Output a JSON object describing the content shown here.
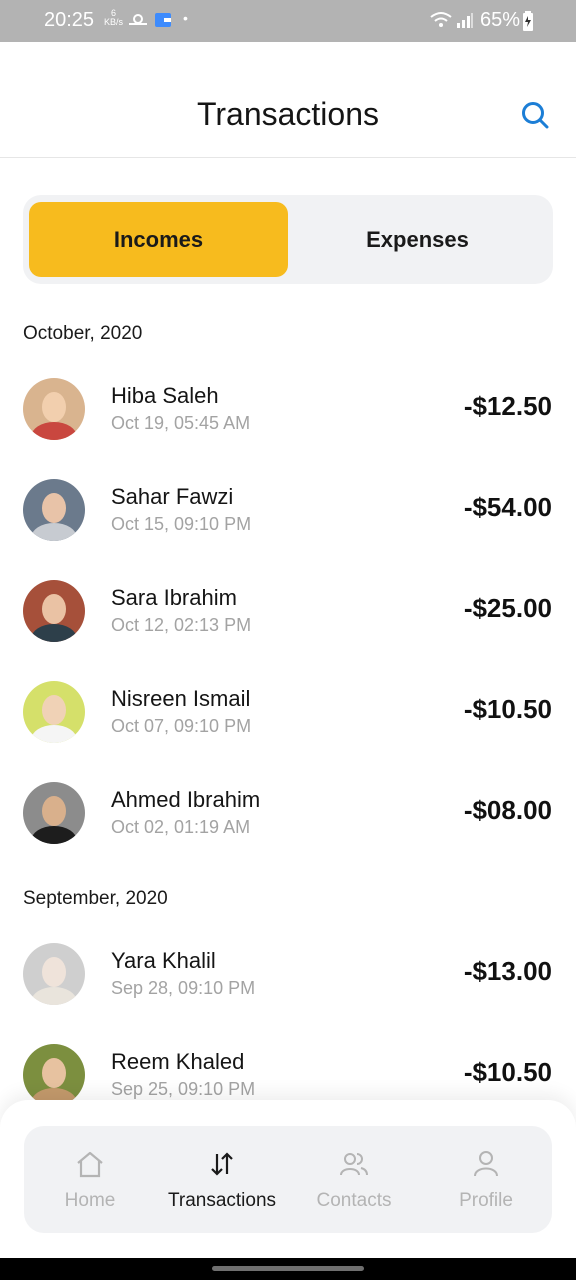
{
  "status_bar": {
    "time": "20:25",
    "kbs_value": "6",
    "kbs_unit": "KB/s",
    "battery": "65%"
  },
  "header": {
    "title": "Transactions"
  },
  "tabs": [
    {
      "label": "Incomes",
      "active": true
    },
    {
      "label": "Expenses",
      "active": false
    }
  ],
  "sections": [
    {
      "title": "October, 2020",
      "items": [
        {
          "name": "Hiba Saleh",
          "date": "Oct 19, 05:45 AM",
          "amount": "-$12.50"
        },
        {
          "name": "Sahar Fawzi",
          "date": "Oct 15, 09:10 PM",
          "amount": "-$54.00"
        },
        {
          "name": "Sara Ibrahim",
          "date": "Oct 12, 02:13 PM",
          "amount": "-$25.00"
        },
        {
          "name": "Nisreen Ismail",
          "date": "Oct 07, 09:10 PM",
          "amount": "-$10.50"
        },
        {
          "name": "Ahmed Ibrahim",
          "date": "Oct 02, 01:19 AM",
          "amount": "-$08.00"
        }
      ]
    },
    {
      "title": "September, 2020",
      "items": [
        {
          "name": "Yara Khalil",
          "date": "Sep 28, 09:10 PM",
          "amount": "-$13.00"
        },
        {
          "name": "Reem Khaled",
          "date": "Sep 25, 09:10 PM",
          "amount": "-$10.50"
        }
      ]
    }
  ],
  "nav": [
    {
      "label": "Home",
      "icon": "home-icon",
      "active": false
    },
    {
      "label": "Transactions",
      "icon": "transfer-arrows-icon",
      "active": true
    },
    {
      "label": "Contacts",
      "icon": "contacts-icon",
      "active": false
    },
    {
      "label": "Profile",
      "icon": "profile-icon",
      "active": false
    }
  ],
  "colors": {
    "accent": "#f7bb1e",
    "search_icon": "#1c7ed6"
  }
}
